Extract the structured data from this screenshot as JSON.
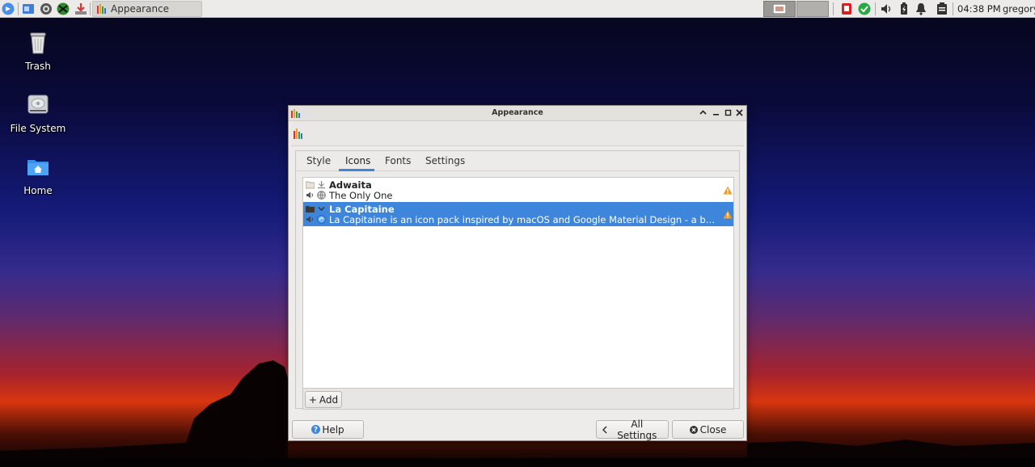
{
  "panel": {
    "task_title": "Appearance",
    "clock": "04:38 PM",
    "user": "gregory"
  },
  "desktop": {
    "icons": [
      {
        "label": "Trash"
      },
      {
        "label": "File System"
      },
      {
        "label": "Home"
      }
    ]
  },
  "window": {
    "title": "Appearance",
    "tabs": [
      {
        "label": "Style"
      },
      {
        "label": "Icons"
      },
      {
        "label": "Fonts"
      },
      {
        "label": "Settings"
      }
    ],
    "active_tab": "Icons",
    "themes": [
      {
        "name": "Adwaita",
        "description": "The Only One",
        "selected": false
      },
      {
        "name": "La Capitaine",
        "description": "La Capitaine is an icon pack inspired by macOS and Google Material Design - a beautiful …",
        "selected": true
      }
    ],
    "add_label": "Add",
    "help_label": "Help",
    "all_settings_label": "All Settings",
    "close_label": "Close"
  },
  "colors": {
    "accent": "#3d86dc",
    "warning": "#f29a1c"
  }
}
